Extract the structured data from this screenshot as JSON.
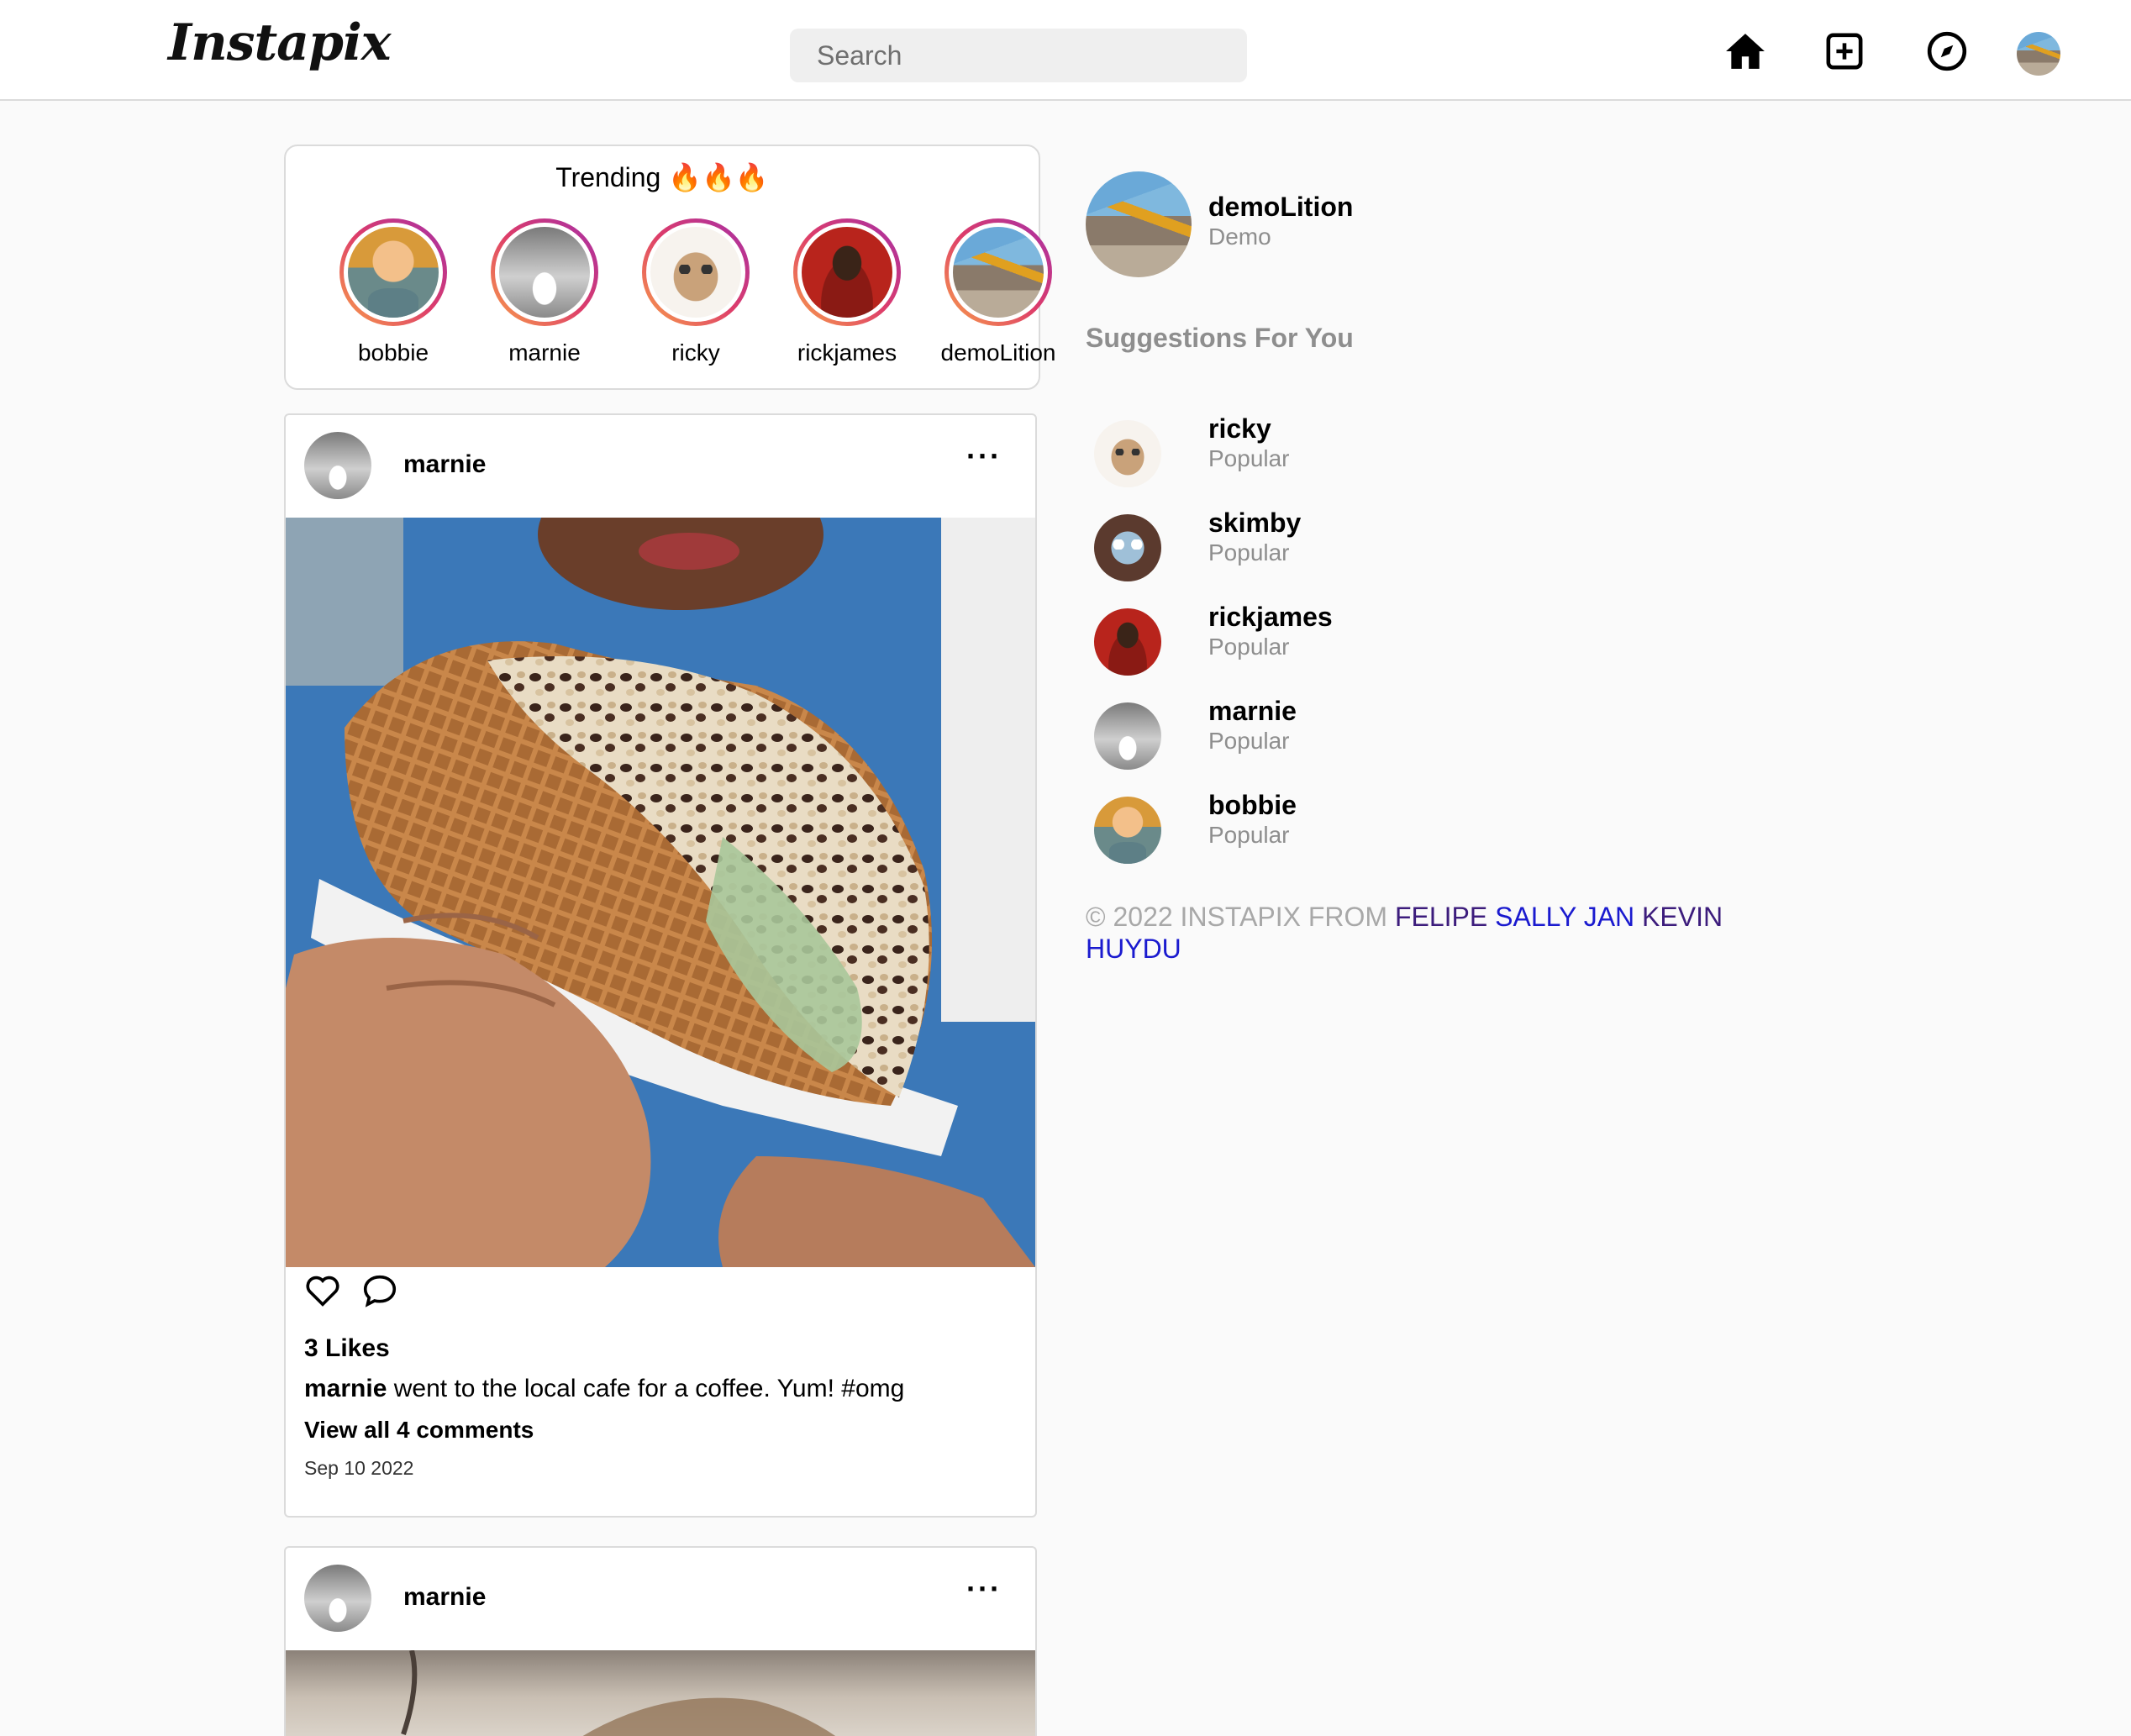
{
  "nav": {
    "logo": "Instapix",
    "search_placeholder": "Search",
    "icons": [
      "home-icon",
      "add-post-icon",
      "explore-icon"
    ]
  },
  "trending": {
    "title": "Trending 🔥🔥🔥",
    "users": [
      "bobbie",
      "marnie",
      "ricky",
      "rickjames",
      "demoLition"
    ]
  },
  "posts": [
    {
      "username": "marnie",
      "more": "···",
      "likes": "3 Likes",
      "caption_user": "marnie",
      "caption_text": "went to the local cafe for a coffee. Yum! #omg",
      "comments_link": "View all 4 comments",
      "date": "Sep 10 2022"
    },
    {
      "username": "marnie",
      "more": "···"
    }
  ],
  "current_user": {
    "username": "demoLition",
    "name": "Demo"
  },
  "suggestions": {
    "title": "Suggestions For You",
    "items": [
      {
        "username": "ricky",
        "label": "Popular"
      },
      {
        "username": "skimby",
        "label": "Popular"
      },
      {
        "username": "rickjames",
        "label": "Popular"
      },
      {
        "username": "marnie",
        "label": "Popular"
      },
      {
        "username": "bobbie",
        "label": "Popular"
      }
    ]
  },
  "footer": {
    "prefix": "© 2022 INSTAPIX FROM",
    "authors": [
      "FELIPE",
      "SALLY",
      "JAN",
      "KEVIN",
      "HUYDU"
    ]
  },
  "colors": {
    "footer_visited": "#3c1c7c",
    "footer_link": "#1a1acf",
    "muted": "#8e8e8e"
  }
}
